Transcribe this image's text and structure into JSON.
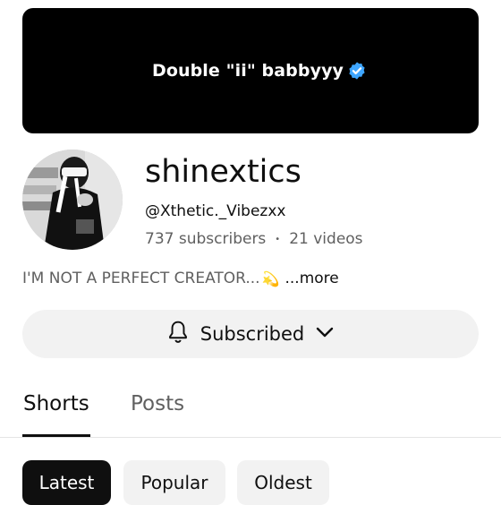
{
  "banner": {
    "text": "Double \"ii\" babbyyy",
    "verified_icon": "verified-badge-icon",
    "badge_color": "#3ea6ff"
  },
  "channel": {
    "name": "shinextics",
    "handle": "@Xthetic._Vibezxx",
    "subscribers": "737 subscribers",
    "separator": "•",
    "videos": "21 videos",
    "description": "I'M NOT A PERFECT CREATOR...",
    "description_emoji": "💫",
    "more_label": "...more"
  },
  "subscribe_button": {
    "label": "Subscribed",
    "bell_icon": "bell-icon",
    "chevron_icon": "chevron-down-icon"
  },
  "tabs": [
    {
      "label": "Shorts",
      "selected": true
    },
    {
      "label": "Posts",
      "selected": false
    }
  ],
  "filters": [
    {
      "label": "Latest",
      "selected": true
    },
    {
      "label": "Popular",
      "selected": false
    },
    {
      "label": "Oldest",
      "selected": false
    }
  ]
}
